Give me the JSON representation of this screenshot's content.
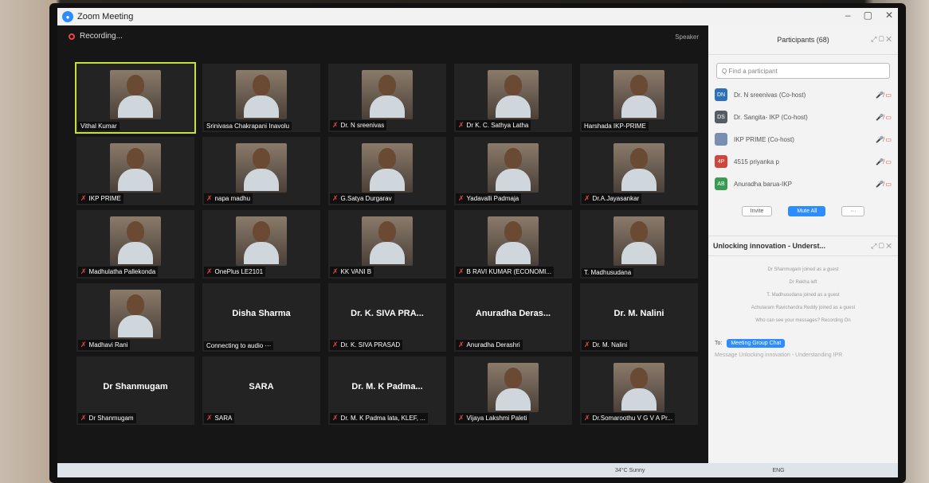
{
  "window": {
    "title": "Zoom Meeting",
    "recording": "Recording..."
  },
  "meeting": {
    "view_label": "Speaker",
    "tiles": [
      {
        "name": "Vithal Kumar",
        "muted": false,
        "speaking": true
      },
      {
        "name": "Srinivasa Chakrapani Inavolu",
        "muted": false
      },
      {
        "name": "Dr. N sreenivas",
        "muted": true
      },
      {
        "name": "Dr K. C. Sathya Latha",
        "muted": true
      },
      {
        "name": "Harshada IKP-PRIME",
        "muted": false
      },
      {
        "name": "IKP PRIME",
        "muted": true
      },
      {
        "name": "napa madhu",
        "muted": true
      },
      {
        "name": "G.Satya Durgarav",
        "muted": true
      },
      {
        "name": "Yadavalli Padmaja",
        "muted": true
      },
      {
        "name": "Dr.A.Jayasankar",
        "muted": true
      },
      {
        "name": "Madhulatha Pallekonda",
        "muted": true
      },
      {
        "name": "OnePlus LE2101",
        "muted": true
      },
      {
        "name": "KK VANI B",
        "muted": true
      },
      {
        "name": "B RAVI KUMAR (ECONOMI...",
        "muted": true
      },
      {
        "name": "T. Madhusudana",
        "muted": false
      },
      {
        "name": "Madhavi Rani",
        "muted": true
      },
      {
        "name": "Connecting to audio ···",
        "muted": false,
        "center": "Disha Sharma"
      },
      {
        "name": "Dr. K. SIVA PRASAD",
        "muted": true,
        "center": "Dr. K. SIVA PRA..."
      },
      {
        "name": "Anuradha Derashri",
        "muted": true,
        "center": "Anuradha Deras..."
      },
      {
        "name": "Dr. M. Nalini",
        "muted": true,
        "center": "Dr. M. Nalini"
      },
      {
        "name": "Dr Shanmugam",
        "muted": true,
        "center": "Dr Shanmugam"
      },
      {
        "name": "SARA",
        "muted": true,
        "center": "SARA"
      },
      {
        "name": "Dr. M. K Padma lata, KLEF, ...",
        "muted": true,
        "center": "Dr. M. K Padma..."
      },
      {
        "name": "Vijaya Lakshmi Paleti",
        "muted": true
      },
      {
        "name": "Dr.Somaroothu V G V A Pr...",
        "muted": true
      }
    ]
  },
  "participants": {
    "title": "Participants (68)",
    "search_placeholder": "Q Find a participant",
    "list": [
      {
        "initials": "DN",
        "name": "Dr. N sreenivas (Co-host)",
        "color": "#2e6fb8"
      },
      {
        "initials": "DS",
        "name": "Dr. Sangita- IKP (Co-host)",
        "color": "#555c66"
      },
      {
        "initials": "",
        "name": "IKP PRIME (Co-host)",
        "color": "#7a8fb0"
      },
      {
        "initials": "4P",
        "name": "4515 priyanka p",
        "color": "#d0453c"
      },
      {
        "initials": "AB",
        "name": "Anuradha barua-IKP",
        "color": "#3b9a52"
      }
    ],
    "invite": "Invite",
    "mute_all": "Mute All",
    "more": "···"
  },
  "chat": {
    "title": "Unlocking innovation - Underst...",
    "messages": [
      "Dr Shanmugam joined as a guest",
      "Dr Rekha left",
      "T. Madhusudana joined as a guest",
      "Achutaram Ravichandra Reddy joined as a guest",
      "Who can see your messages? Recording On"
    ],
    "to_label": "To:",
    "to_target": "Meeting Group Chat",
    "compose_placeholder": "Message Unlocking innovation - Understanding IPR"
  },
  "taskbar": {
    "weather": "34°C Sunny",
    "lang": "ENG"
  }
}
